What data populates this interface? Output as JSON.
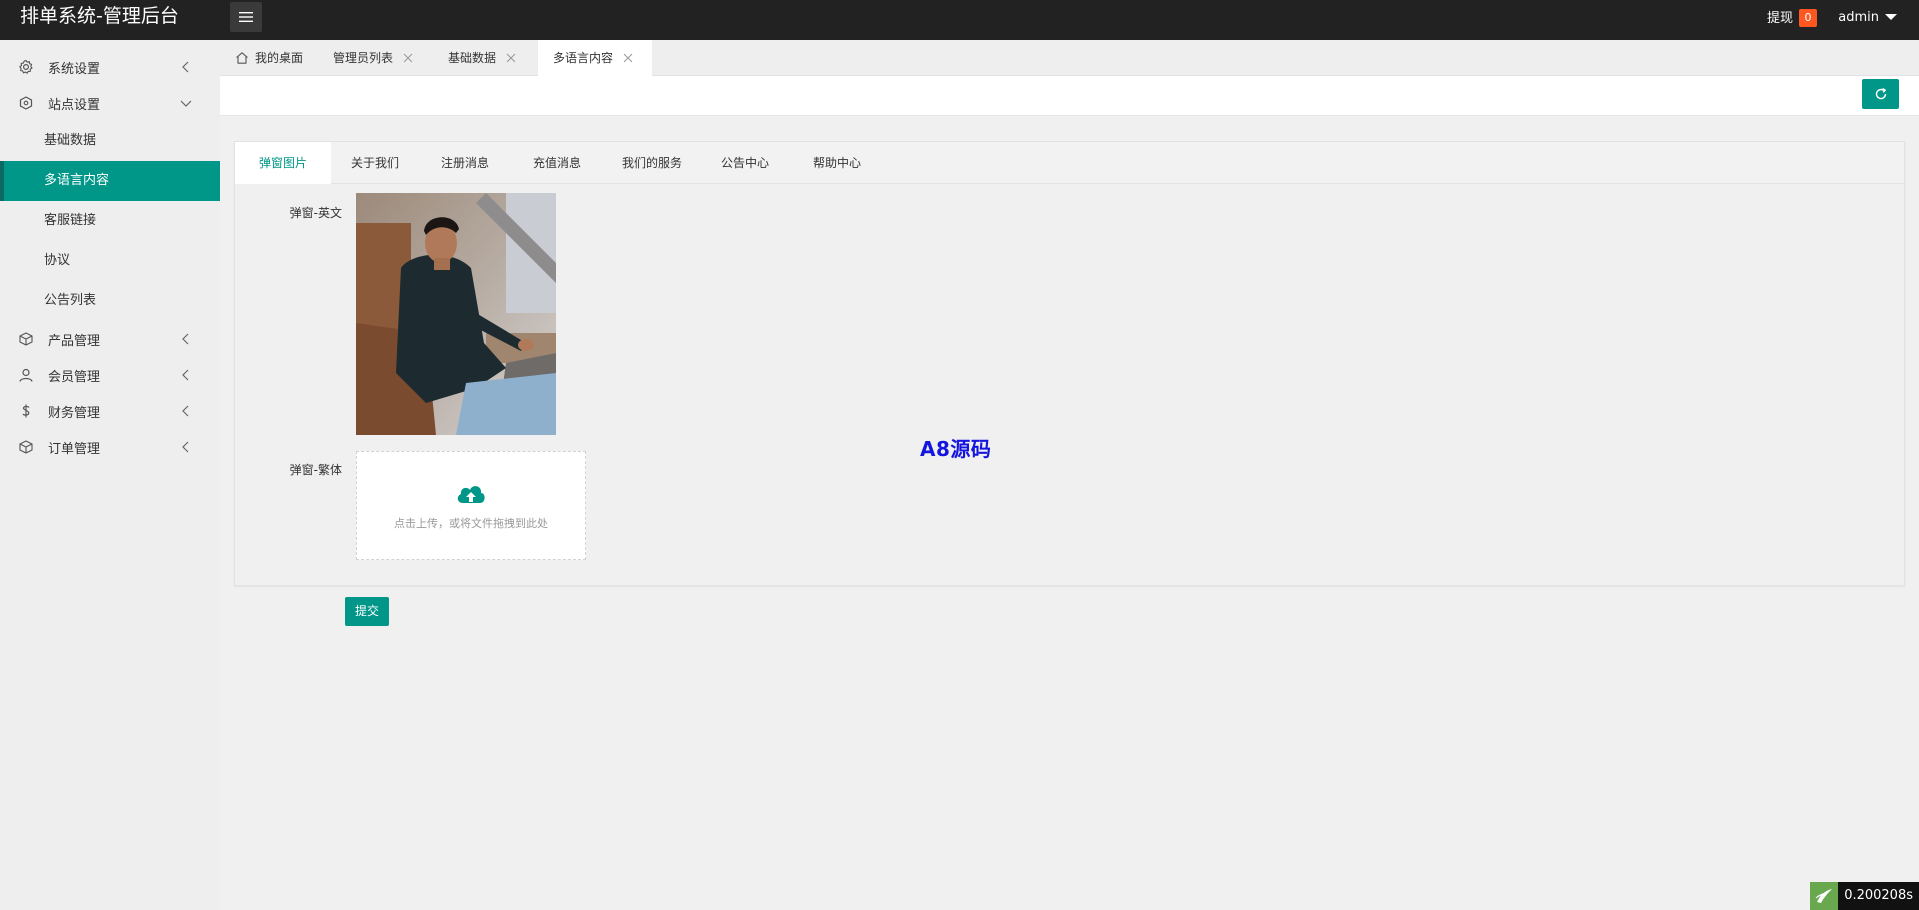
{
  "header": {
    "title": "排单系统-管理后台",
    "withdraw_label": "提现",
    "withdraw_count": "0",
    "username": "admin"
  },
  "sidebar": {
    "items": [
      {
        "label": "系统设置",
        "icon": "gear-icon"
      },
      {
        "label": "站点设置",
        "icon": "site-icon",
        "expanded": true,
        "children": [
          "基础数据",
          "多语言内容",
          "客服链接",
          "协议",
          "公告列表"
        ],
        "active_child": "多语言内容"
      },
      {
        "label": "产品管理",
        "icon": "box-icon"
      },
      {
        "label": "会员管理",
        "icon": "user-icon"
      },
      {
        "label": "财务管理",
        "icon": "dollar-icon"
      },
      {
        "label": "订单管理",
        "icon": "box-icon"
      }
    ]
  },
  "tabs": [
    {
      "label": "我的桌面",
      "closable": false
    },
    {
      "label": "管理员列表",
      "closable": true
    },
    {
      "label": "基础数据",
      "closable": true
    },
    {
      "label": "多语言内容",
      "closable": true,
      "active": true
    }
  ],
  "content": {
    "section_tabs": [
      "弹窗图片",
      "关于我们",
      "注册消息",
      "充值消息",
      "我们的服务",
      "公告中心",
      "帮助中心"
    ],
    "active_section": "弹窗图片",
    "field_en_label": "弹窗-英文",
    "field_tw_label": "弹窗-繁体",
    "upload_hint": "点击上传，或将文件拖拽到此处",
    "submit_label": "提交",
    "watermark": "A8源码"
  },
  "footer": {
    "timing": "0.200208s"
  },
  "colors": {
    "accent": "#009688",
    "header_bg": "#222222",
    "badge": "#ff5722",
    "watermark": "#1515e0"
  }
}
